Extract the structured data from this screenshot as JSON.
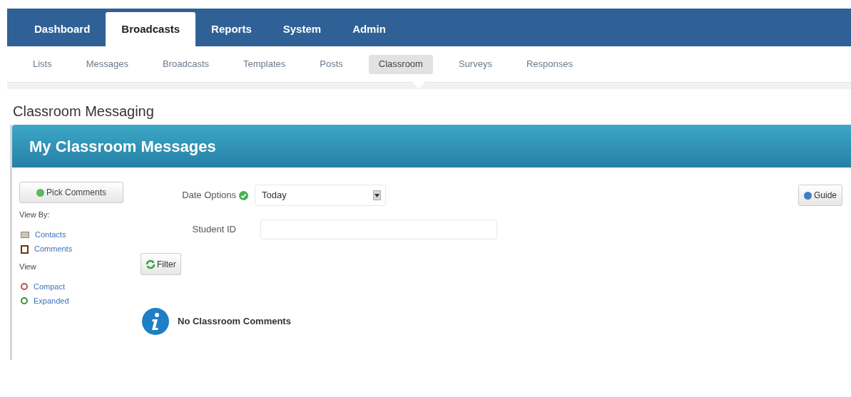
{
  "main_tabs": [
    {
      "label": "Dashboard",
      "selected": false
    },
    {
      "label": "Broadcasts",
      "selected": true
    },
    {
      "label": "Reports",
      "selected": false
    },
    {
      "label": "System",
      "selected": false
    },
    {
      "label": "Admin",
      "selected": false
    }
  ],
  "sub_tabs": [
    {
      "label": "Lists",
      "selected": false
    },
    {
      "label": "Messages",
      "selected": false
    },
    {
      "label": "Broadcasts",
      "selected": false
    },
    {
      "label": "Templates",
      "selected": false
    },
    {
      "label": "Posts",
      "selected": false
    },
    {
      "label": "Classroom",
      "selected": true
    },
    {
      "label": "Surveys",
      "selected": false
    },
    {
      "label": "Responses",
      "selected": false
    }
  ],
  "page_title": "Classroom Messaging",
  "panel_title": "My Classroom Messages",
  "sidebar": {
    "pick_button": "Pick Comments",
    "view_by_label": "View By:",
    "view_by_links": [
      {
        "label": "Contacts",
        "kind": "contacts"
      },
      {
        "label": "Comments",
        "kind": "comments"
      }
    ],
    "view_label": "View",
    "view_links": [
      {
        "label": "Compact",
        "kind": "compact"
      },
      {
        "label": "Expanded",
        "kind": "expanded"
      }
    ]
  },
  "form": {
    "date_label": "Date Options",
    "date_value": "Today",
    "student_label": "Student ID",
    "filter_button": "Filter"
  },
  "guide_button": "Guide",
  "empty_message": "No Classroom Comments"
}
